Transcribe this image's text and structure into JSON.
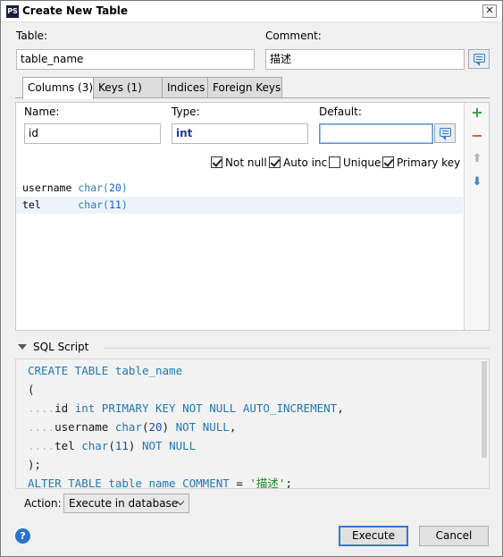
{
  "window": {
    "title": "Create New Table",
    "app_icon": "PS",
    "close_glyph": "✕"
  },
  "table_label": "Table:",
  "table_value": "table_name",
  "comment_label": "Comment:",
  "comment_value": "描述",
  "tabs": [
    {
      "label": "Columns (3)",
      "active": true
    },
    {
      "label": "Keys (1)",
      "active": false
    },
    {
      "label": "Indices",
      "active": false
    },
    {
      "label": "Foreign Keys",
      "active": false
    }
  ],
  "column_editor": {
    "name_label": "Name:",
    "name_value": "id",
    "type_label": "Type:",
    "type_value": "int",
    "default_label": "Default:",
    "default_value": "",
    "checkboxes": [
      {
        "label": "Not null",
        "checked": true
      },
      {
        "label": "Auto inc",
        "checked": true
      },
      {
        "label": "Unique",
        "checked": false
      },
      {
        "label": "Primary key",
        "checked": true
      }
    ]
  },
  "columns": [
    {
      "name": "username",
      "pad": "",
      "type": "char",
      "size": "20"
    },
    {
      "name": "tel",
      "pad": "     ",
      "type": "char",
      "size": "11"
    }
  ],
  "toolbar": {
    "add_icon": "plus-icon",
    "remove_icon": "minus-icon",
    "up_icon": "arrow-up-icon",
    "down_icon": "arrow-down-icon"
  },
  "sql_section": {
    "title": "SQL Script"
  },
  "sql_lines": {
    "l1_kw": "CREATE TABLE",
    "l1_name": " table_name",
    "l2": "(",
    "l3_dots": "....",
    "l3_col": "id ",
    "l3_kw": "int PRIMARY KEY NOT NULL AUTO_INCREMENT",
    "l3_end": ",",
    "l4_dots": "....",
    "l4_col": "username ",
    "l4_type": "char",
    "l4_paren_open": "(",
    "l4_num": "20",
    "l4_paren_close": ") ",
    "l4_kw": "NOT NULL",
    "l4_end": ",",
    "l5_dots": "....",
    "l5_col": "tel ",
    "l5_type": "char",
    "l5_paren_open": "(",
    "l5_num": "11",
    "l5_paren_close": ") ",
    "l5_kw": "NOT NULL",
    "l6": ");",
    "l7_kw": "ALTER TABLE",
    "l7_name": " table_name ",
    "l7_kw2": "COMMENT",
    "l7_eq": " = ",
    "l7_str": "'描述'",
    "l7_end": ";"
  },
  "action": {
    "label": "Action:",
    "selected": "Execute in database"
  },
  "buttons": {
    "execute": "Execute",
    "cancel": "Cancel",
    "help": "?"
  }
}
